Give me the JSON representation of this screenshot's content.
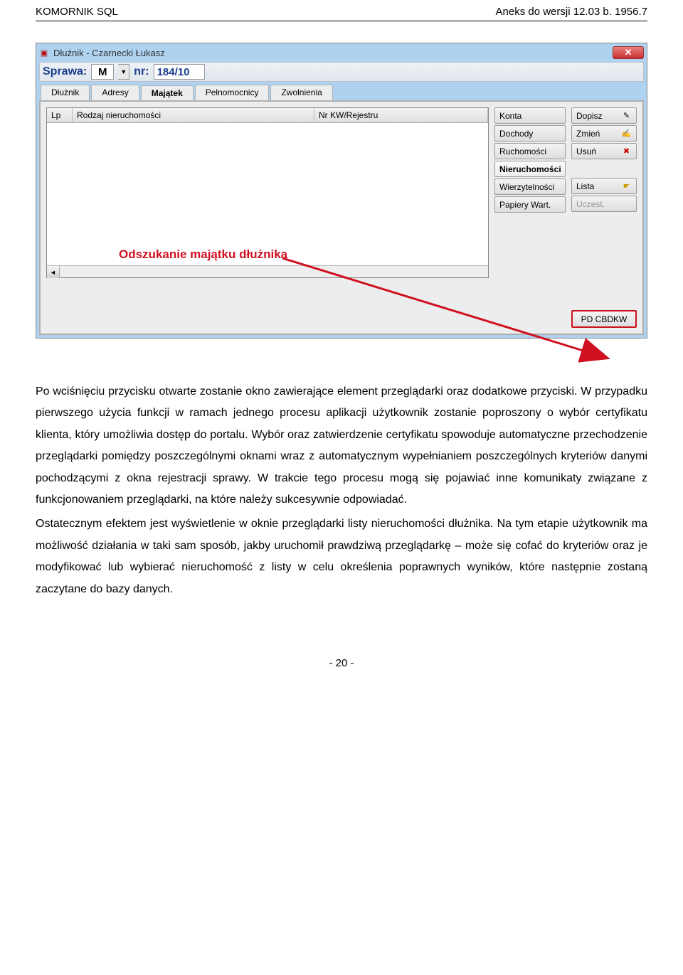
{
  "header": {
    "left": "KOMORNIK SQL",
    "right": "Aneks do wersji 12.03 b. 1956.7"
  },
  "window": {
    "title": "Dłużnik - Czarnecki Łukasz",
    "sprawa": {
      "label": "Sprawa:",
      "type": "M",
      "nr_label": "nr:",
      "nr": "184/10"
    },
    "tabs": [
      "Dłużnik",
      "Adresy",
      "Majątek",
      "Pełnomocnicy",
      "Zwolnienia"
    ],
    "table": {
      "columns": [
        "Lp",
        "Rodzaj nieruchomości",
        "Nr KW/Rejestru"
      ]
    },
    "side": [
      "Konta",
      "Dochody",
      "Ruchomości",
      "Nieruchomości",
      "Wierzytelności",
      "Papiery Wart."
    ],
    "actions": [
      {
        "label": "Dopisz",
        "iconChar": "✎"
      },
      {
        "label": "Zmień",
        "iconChar": "✍"
      },
      {
        "label": "Usuń",
        "iconChar": "✖"
      }
    ],
    "list": {
      "label": "Lista",
      "iconChar": "☛"
    },
    "uczest": "Uczest.",
    "bottom": "PD CBDKW"
  },
  "annotation": "Odszukanie majątku dłużnika",
  "paragraphs": [
    "Po wciśnięciu przycisku otwarte zostanie okno zawierające element przeglądarki oraz dodatkowe przyciski. W przypadku pierwszego użycia funkcji w ramach jednego procesu aplikacji użytkownik zostanie poproszony o wybór certyfikatu klienta, który umożliwia dostęp do portalu. Wybór oraz zatwierdzenie certyfikatu spowoduje automatyczne przechodzenie przeglądarki pomiędzy poszczególnymi oknami wraz z automatycznym wypełnianiem poszczególnych kryteriów danymi pochodzącymi z okna rejestracji sprawy. W trakcie tego procesu mogą się pojawiać inne komunikaty związane z funkcjonowaniem przeglądarki, na które należy sukcesywnie odpowiadać.",
    "Ostatecznym efektem jest wyświetlenie w oknie przeglądarki listy nieruchomości dłużnika. Na tym etapie użytkownik ma możliwość działania w taki sam sposób, jakby uruchomił prawdziwą przeglądarkę – może się cofać do kryteriów oraz je modyfikować lub wybierać nieruchomość z listy w celu określenia poprawnych wyników, które następnie zostaną zaczytane do bazy danych."
  ],
  "footer": "- 20 -"
}
